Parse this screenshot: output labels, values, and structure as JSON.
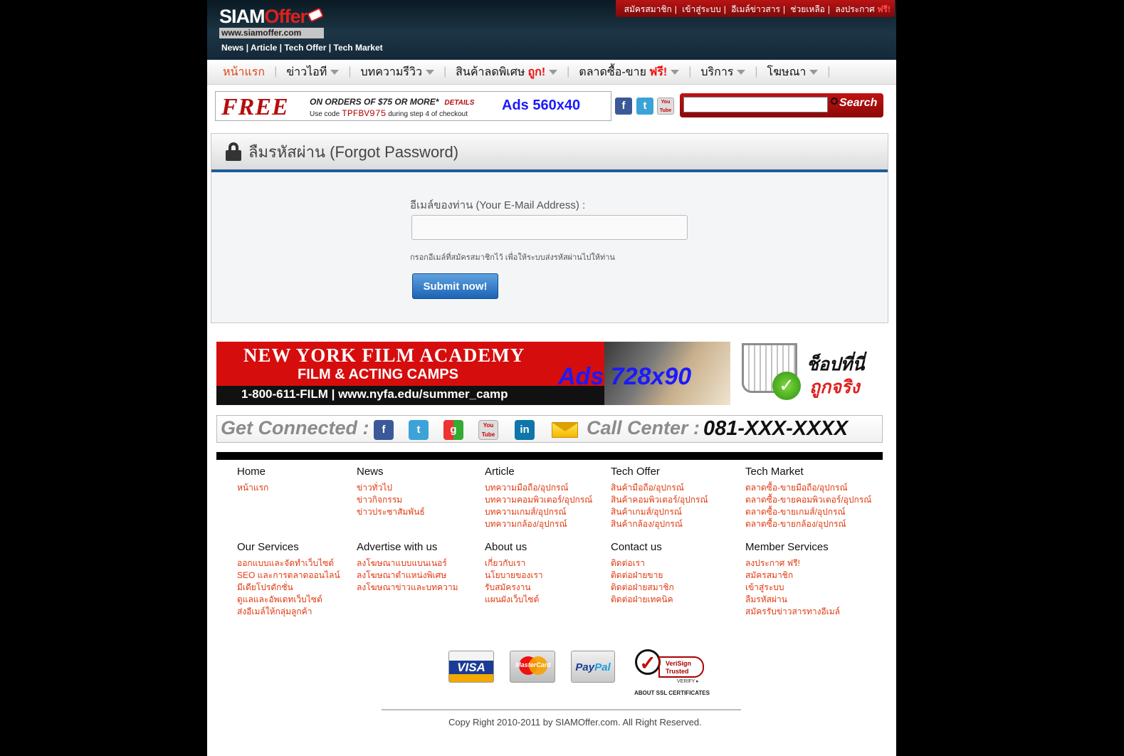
{
  "header": {
    "logo_brand_main": "SIAM",
    "logo_brand_accent": "Offer",
    "logo_url": "www.siamoffer.com",
    "logo_nav": [
      "News",
      "Article",
      "Tech Offer",
      "Tech Market"
    ],
    "top_links": [
      "สมัครสมาชิก",
      "เข้าสู่ระบบ",
      "อีเมล์ข่าวสาร",
      "ช่วยเหลือ",
      "ลงประกาศ"
    ],
    "top_links_free": "ฟรี!"
  },
  "nav": {
    "items": [
      {
        "label": "หน้าแรก",
        "active": true,
        "dropdown": false,
        "highlight": ""
      },
      {
        "label": "ข่าวไอที",
        "active": false,
        "dropdown": true,
        "highlight": ""
      },
      {
        "label": "บทความรีวิว",
        "active": false,
        "dropdown": true,
        "highlight": ""
      },
      {
        "label": "สินค้าลดพิเศษ",
        "active": false,
        "dropdown": true,
        "highlight": "ถูก!"
      },
      {
        "label": "ตลาดซื้อ-ขาย",
        "active": false,
        "dropdown": true,
        "highlight": "ฟรี!"
      },
      {
        "label": "บริการ",
        "active": false,
        "dropdown": true,
        "highlight": ""
      },
      {
        "label": "โฆษณา",
        "active": false,
        "dropdown": true,
        "highlight": ""
      }
    ]
  },
  "ad_small": {
    "free": "FREE",
    "line1": "ON ORDERS OF $75 OR MORE*",
    "details": "DETAILS",
    "line2_prefix": "Use code",
    "code": "TPFBV975",
    "line2_suffix": "during step 4 of checkout",
    "label": "Ads 560x40"
  },
  "social_small": [
    "f",
    "t",
    "You Tube"
  ],
  "search": {
    "placeholder": "",
    "button": "Search"
  },
  "panel": {
    "title": "ลืมรหัสผ่าน (Forgot Password)",
    "email_label": "อีเมล์ของท่าน (Your E-Mail Address) :",
    "email_value": "",
    "hint": "กรอกอีเมล์ที่สมัครสมาชิกไว้ เพื่อให้ระบบส่งรหัสผ่านไปให้ท่าน",
    "submit": "Submit now!"
  },
  "banner": {
    "line1": "NEW YORK FILM ACADEMY",
    "line2": "FILM & ACTING CAMPS",
    "line3": "1-800-611-FILM  |  www.nyfa.edu/summer_camp",
    "label": "Ads 728x90"
  },
  "shop": {
    "line1": "ช็อปที่นี่",
    "line2": "ถูกจริง"
  },
  "connect": {
    "label": "Get Connected :",
    "icons": [
      "f",
      "t",
      "g",
      "You Tube",
      "in"
    ],
    "call_label": "Call Center :",
    "phone": "081-XXX-XXXX"
  },
  "footer": {
    "columns": [
      {
        "heading": "Home",
        "links": [
          "หน้าแรก"
        ]
      },
      {
        "heading": "News",
        "links": [
          "ข่าวทั่วไป",
          "ข่าวกิจกรรม",
          "ข่าวประชาสัมพันธ์"
        ]
      },
      {
        "heading": "Article",
        "links": [
          "บทความมือถือ/อุปกรณ์",
          "บทความคอมพิวเตอร์/อุปกรณ์",
          "บทความเกมส์/อุปกรณ์",
          "บทความกล้อง/อุปกรณ์"
        ]
      },
      {
        "heading": "Tech Offer",
        "links": [
          "สินค้ามือถือ/อุปกรณ์",
          "สินค้าคอมพิวเตอร์/อุปกรณ์",
          "สินค้าเกมส์/อุปกรณ์",
          "สินค้ากล้อง/อุปกรณ์"
        ]
      },
      {
        "heading": "Tech Market",
        "links": [
          "ตลาดซื้อ-ขายมือถือ/อุปกรณ์",
          "ตลาดซื้อ-ขายคอมพิวเตอร์/อุปกรณ์",
          "ตลาดซื้อ-ขายเกมส์/อุปกรณ์",
          "ตลาดซื้อ-ขายกล้อง/อุปกรณ์"
        ]
      },
      {
        "heading": "Our Services",
        "links": [
          "ออกแบบและจัดทำเว็บไซต์",
          "SEO และการตลาดออนไลน์",
          "มีเดียโปรดักชั่น",
          "ดูแลและอัพเดทเว็บไซต์",
          "ส่งอีเมล์ให้กลุ่มลูกค้า"
        ]
      },
      {
        "heading": "Advertise with us",
        "links": [
          "ลงโฆษณาแบบแบนเนอร์",
          "ลงโฆษณาตำแหน่งพิเศษ",
          "ลงโฆษณาข่าวและบทความ"
        ]
      },
      {
        "heading": "About us",
        "links": [
          "เกี่ยวกับเรา",
          "นโยบายของเรา",
          "รับสมัครงาน",
          "แผนผังเว็บไซต์"
        ]
      },
      {
        "heading": "Contact us",
        "links": [
          "ติดต่อเรา",
          "ติดต่อฝ่ายขาย",
          "ติดต่อฝ่ายสมาชิก",
          "ติดต่อฝ่ายเทคนิค"
        ]
      },
      {
        "heading": "Member Services",
        "links": [
          "ลงประกาศ ฟรี!",
          "สมัครสมาชิก",
          "เข้าสู่ระบบ",
          "ลืมรหัสผ่าน",
          "สมัครรับข่าวสารทางอีเมล์"
        ]
      }
    ],
    "payments": {
      "visa": "VISA",
      "mastercard": "MasterCard",
      "paypal_1": "Pay",
      "paypal_2": "Pal"
    },
    "verisign": {
      "line1": "VeriSign",
      "line2": "Trusted",
      "verify": "VERIFY ▸",
      "about": "ABOUT SSL CERTIFICATES"
    },
    "copyright": "Copy Right 2010-2011 by SIAMOffer.com. All Right Reserved."
  }
}
